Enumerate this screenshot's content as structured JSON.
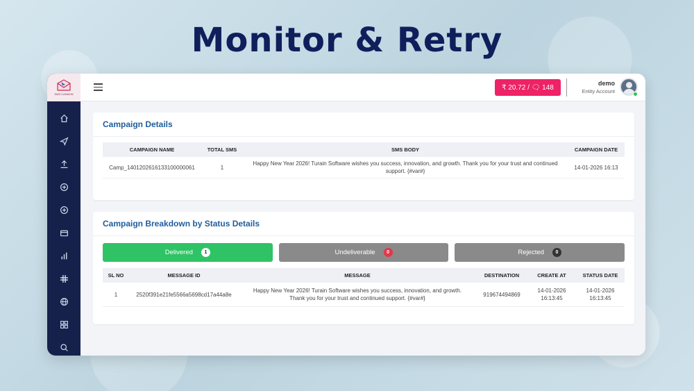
{
  "hero": {
    "title": "Monitor & Retry"
  },
  "brand": {
    "logo_text": "SMS CANNON"
  },
  "sidebar": {
    "items": [
      {
        "icon": "home-icon"
      },
      {
        "icon": "send-icon"
      },
      {
        "icon": "upload-icon"
      },
      {
        "icon": "add-circle-icon"
      },
      {
        "icon": "add-circle-icon"
      },
      {
        "icon": "card-icon"
      },
      {
        "icon": "bar-chart-icon"
      },
      {
        "icon": "slack-icon"
      },
      {
        "icon": "globe-icon"
      },
      {
        "icon": "grid-icon"
      },
      {
        "icon": "search-icon"
      }
    ]
  },
  "topbar": {
    "wallet": "₹ 20.72 / 🗨 148",
    "user_name": "demo",
    "user_role": "Entity Account"
  },
  "campaign_details": {
    "title": "Campaign Details",
    "headers": [
      "CAMPAIGN NAME",
      "TOTAL SMS",
      "SMS BODY",
      "CAMPAIGN DATE"
    ],
    "row": {
      "name": "Camp_1401202616133100000061",
      "total": "1",
      "body": "Happy New Year 2026! Turain Software wishes you success, innovation, and growth. Thank you for your trust and continued support. {#var#}",
      "date": "14-01-2026 16:13"
    }
  },
  "breakdown": {
    "title": "Campaign Breakdown by Status Details",
    "tabs": {
      "delivered": {
        "label": "Delivered",
        "count": "1"
      },
      "undeliverable": {
        "label": "Undeliverable",
        "count": "0"
      },
      "rejected": {
        "label": "Rejected",
        "count": "0"
      }
    },
    "headers": [
      "SL NO",
      "MESSAGE ID",
      "MESSAGE",
      "DESTINATION",
      "CREATE AT",
      "STATUS DATE"
    ],
    "row": {
      "sl": "1",
      "message_id": "2520f391e21fe5566a5698cd17a44a8e",
      "message": "Happy New Year 2026! Turain Software wishes you success, innovation, and growth. Thank you for your trust and continued support. {#var#}",
      "destination": "919674494869",
      "created": "14-01-2026 16:13:45",
      "status_date": "14-01-2026 16:13:45"
    }
  },
  "colors": {
    "sidebar": "#16214b",
    "accent_pink": "#ee2266",
    "delivered_green": "#2fc365",
    "title_blue": "#1f5d9c"
  }
}
